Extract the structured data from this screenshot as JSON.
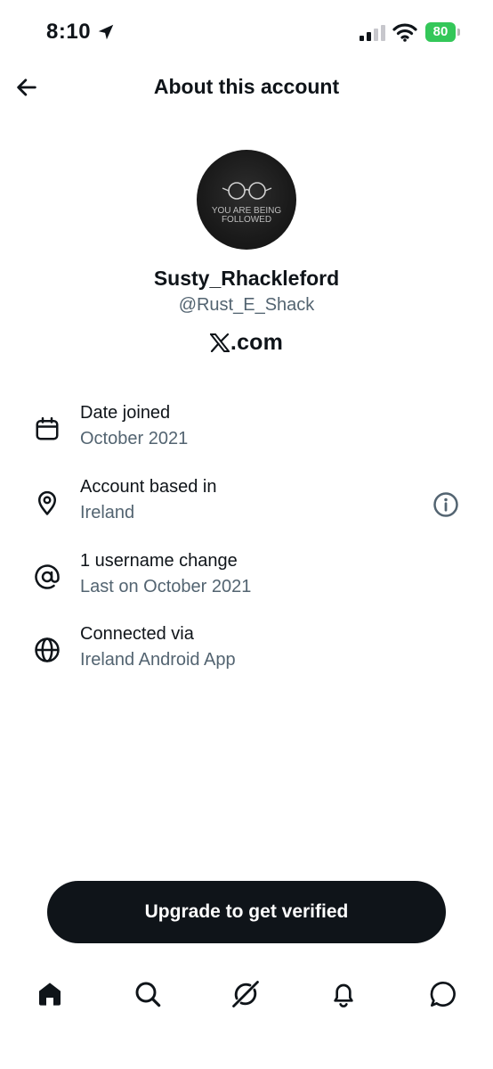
{
  "status_bar": {
    "time": "8:10",
    "battery_percent": "80",
    "icons": [
      "location-arrow-icon",
      "signal-icon",
      "wifi-icon",
      "battery-icon"
    ],
    "battery_color": "#34c759"
  },
  "header": {
    "back_icon": "arrow-left-icon",
    "title": "About this account"
  },
  "profile": {
    "avatar_text_line1": "YOU ARE BEING",
    "avatar_text_line2": "FOLLOWED",
    "display_name": "Susty_Rhackleford",
    "handle": "@Rust_E_Shack",
    "platform_logo_text": ".com"
  },
  "info_rows": [
    {
      "icon": "calendar-icon",
      "label": "Date joined",
      "value": "October 2021"
    },
    {
      "icon": "location-pin-icon",
      "label": "Account based in",
      "value": "Ireland",
      "trailing_icon": "info-circle-icon"
    },
    {
      "icon": "at-sign-icon",
      "label": "1 username change",
      "value": "Last on October 2021"
    },
    {
      "icon": "globe-icon",
      "label": "Connected via",
      "value": "Ireland Android App"
    }
  ],
  "upgrade_button": {
    "label": "Upgrade to get verified"
  },
  "bottom_nav": {
    "items": [
      {
        "icon": "home-icon",
        "active": true
      },
      {
        "icon": "search-icon",
        "active": false
      },
      {
        "icon": "grok-icon",
        "active": false
      },
      {
        "icon": "bell-icon",
        "active": false
      },
      {
        "icon": "messages-icon",
        "active": false
      }
    ]
  },
  "colors": {
    "text_primary": "#0f1419",
    "text_secondary": "#536471",
    "button_bg": "#0f1419",
    "background": "#ffffff"
  }
}
